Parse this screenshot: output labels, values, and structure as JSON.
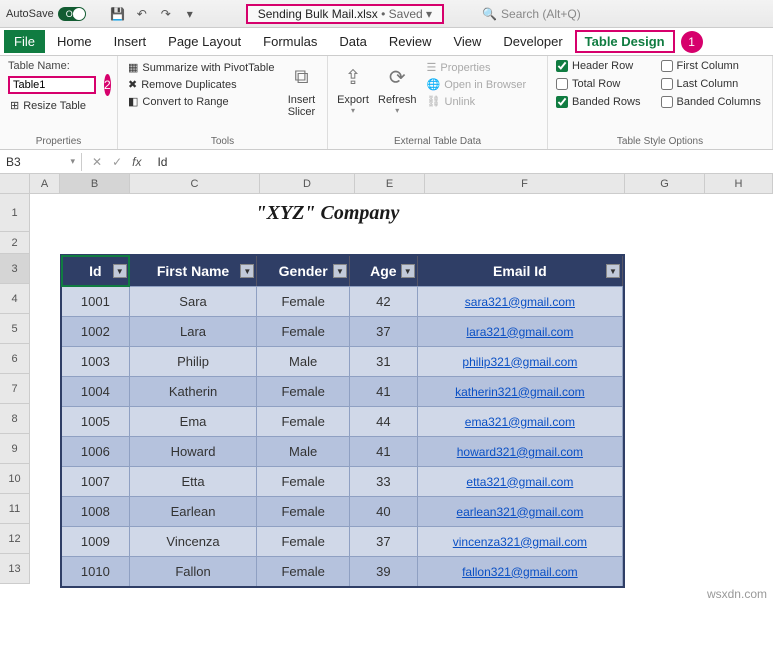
{
  "titlebar": {
    "autosave": "AutoSave",
    "autosave_state": "On",
    "filename": "Sending Bulk Mail.xlsx",
    "saved": "Saved",
    "search_placeholder": "Search (Alt+Q)"
  },
  "tabs": [
    "File",
    "Home",
    "Insert",
    "Page Layout",
    "Formulas",
    "Data",
    "Review",
    "View",
    "Developer",
    "Table Design"
  ],
  "callouts": {
    "tab": "1",
    "tablename": "2"
  },
  "ribbon": {
    "properties": {
      "label": "Properties",
      "table_name_label": "Table Name:",
      "table_name": "Table1",
      "resize": "Resize Table"
    },
    "tools": {
      "label": "Tools",
      "pivot": "Summarize with PivotTable",
      "dup": "Remove Duplicates",
      "range": "Convert to Range",
      "slicer": "Insert\nSlicer"
    },
    "external": {
      "label": "External Table Data",
      "export": "Export",
      "refresh": "Refresh",
      "props": "Properties",
      "browser": "Open in Browser",
      "unlink": "Unlink"
    },
    "styleopts": {
      "label": "Table Style Options",
      "header": "Header Row",
      "total": "Total Row",
      "banded_r": "Banded Rows",
      "first": "First Column",
      "last": "Last Column",
      "banded_c": "Banded Columns"
    }
  },
  "formulabar": {
    "namebox": "B3",
    "value": "Id"
  },
  "columns": [
    "A",
    "B",
    "C",
    "D",
    "E",
    "F",
    "G",
    "H"
  ],
  "rows": [
    "1",
    "2",
    "3",
    "4",
    "5",
    "6",
    "7",
    "8",
    "9",
    "10",
    "11",
    "12",
    "13"
  ],
  "sheet": {
    "title": "\"XYZ\" Company",
    "headers": [
      "Id",
      "First Name",
      "Gender",
      "Age",
      "Email Id"
    ],
    "data": [
      {
        "id": "1001",
        "fn": "Sara",
        "gn": "Female",
        "ag": "42",
        "em": "sara321@gmail.com"
      },
      {
        "id": "1002",
        "fn": "Lara",
        "gn": "Female",
        "ag": "37",
        "em": "lara321@gmail.com"
      },
      {
        "id": "1003",
        "fn": "Philip",
        "gn": "Male",
        "ag": "31",
        "em": "philip321@gmail.com"
      },
      {
        "id": "1004",
        "fn": "Katherin",
        "gn": "Female",
        "ag": "41",
        "em": "katherin321@gmail.com"
      },
      {
        "id": "1005",
        "fn": "Ema",
        "gn": "Female",
        "ag": "44",
        "em": "ema321@gmail.com"
      },
      {
        "id": "1006",
        "fn": "Howard",
        "gn": "Male",
        "ag": "41",
        "em": "howard321@gmail.com"
      },
      {
        "id": "1007",
        "fn": "Etta",
        "gn": "Female",
        "ag": "33",
        "em": "etta321@gmail.com"
      },
      {
        "id": "1008",
        "fn": "Earlean",
        "gn": "Female",
        "ag": "40",
        "em": "earlean321@gmail.com"
      },
      {
        "id": "1009",
        "fn": "Vincenza",
        "gn": "Female",
        "ag": "37",
        "em": "vincenza321@gmail.com"
      },
      {
        "id": "1010",
        "fn": "Fallon",
        "gn": "Female",
        "ag": "39",
        "em": "fallon321@gmail.com"
      }
    ]
  },
  "watermark": "wsxdn.com"
}
